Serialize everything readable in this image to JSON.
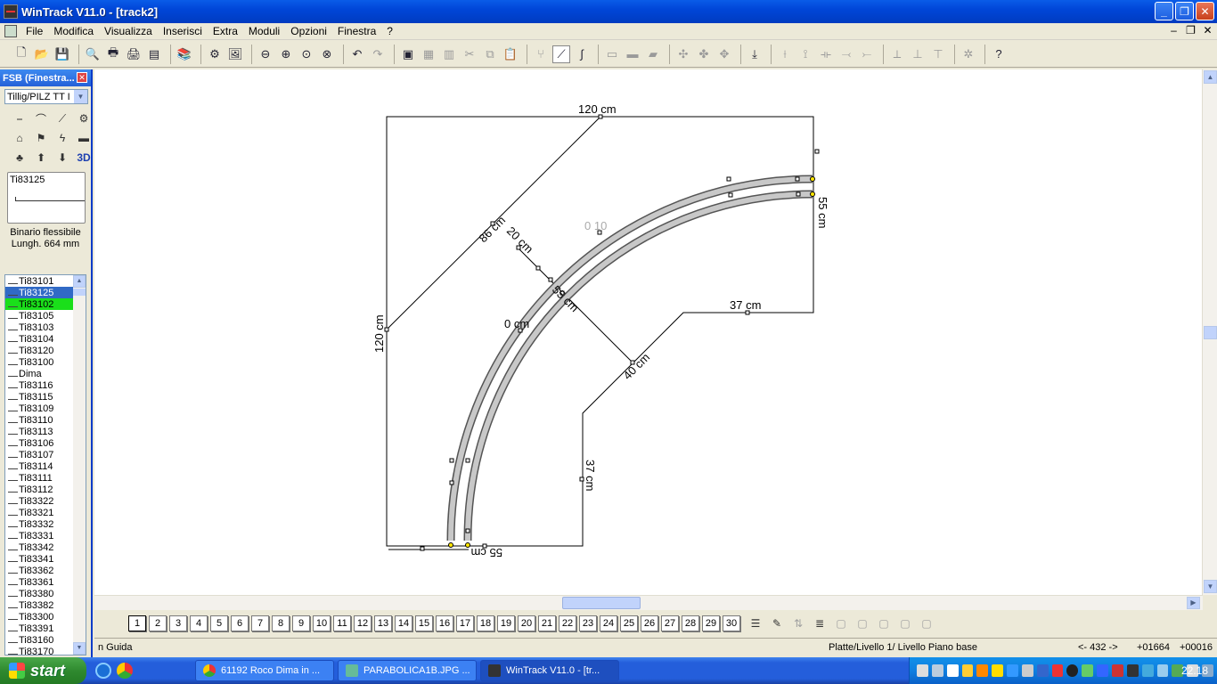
{
  "window": {
    "title": "WinTrack  V11.0 - [track2]",
    "minimize": "_",
    "restore": "❐",
    "close": "✕"
  },
  "menu": {
    "items": [
      "File",
      "Modifica",
      "Visualizza",
      "Inserisci",
      "Extra",
      "Moduli",
      "Opzioni",
      "Finestra",
      "?"
    ],
    "mdi_minimize": "–",
    "mdi_restore": "❐",
    "mdi_close": "✕"
  },
  "panel": {
    "title": "FSB (Finestra...",
    "close": "✕",
    "library_selected": "Tillig/PILZ  TT I",
    "preview_code": "Ti83125",
    "description_line1": "Binario flessibile",
    "description_line2": "Lungh. 664 mm",
    "icon_3d": "3D",
    "parts": [
      "Ti83101",
      "Ti83125",
      "Ti83102",
      "Ti83105",
      "Ti83103",
      "Ti83104",
      "Ti83120",
      "Ti83100",
      "Dima",
      "Ti83116",
      "Ti83115",
      "Ti83109",
      "Ti83110",
      "Ti83113",
      "Ti83106",
      "Ti83107",
      "Ti83114",
      "Ti83111",
      "Ti83112",
      "Ti83322",
      "Ti83321",
      "Ti83332",
      "Ti83331",
      "Ti83342",
      "Ti83341",
      "Ti83362",
      "Ti83361",
      "Ti83380",
      "Ti83382",
      "Ti83300",
      "Ti83391",
      "Ti83160",
      "Ti83170"
    ],
    "selected_index": 1,
    "highlight_index": 2
  },
  "drawing": {
    "dim_top": "120 cm",
    "dim_left": "120 cm",
    "dim_diag": "86 cm",
    "dim_diag2": "20 cm",
    "dim_right": "55 cm",
    "dim_inner_h": "37 cm",
    "dim_inner_v": "37 cm",
    "dim_bottom": "55 cm",
    "dim_inner_diag": "40 cm",
    "dim_inner_diag2": "55 cm",
    "dim_mid": "0 cm",
    "dim_faint": "0 10"
  },
  "layers": {
    "numbers": [
      "1",
      "2",
      "3",
      "4",
      "5",
      "6",
      "7",
      "8",
      "9",
      "10",
      "11",
      "12",
      "13",
      "14",
      "15",
      "16",
      "17",
      "18",
      "19",
      "20",
      "21",
      "22",
      "23",
      "24",
      "25",
      "26",
      "27",
      "28",
      "29",
      "30"
    ],
    "active": "1"
  },
  "status": {
    "guide": "n Guida",
    "layer": "Platte/Livello 1/ Livello Piano base",
    "zoom": "<- 432 ->",
    "x": "+01664",
    "y": "+00016"
  },
  "taskbar": {
    "start": "start",
    "tasks": [
      "61192 Roco Dima in ...",
      "PARABOLICA1B.JPG ...",
      "WinTrack  V11.0 - [tr..."
    ],
    "clock": "22.18"
  }
}
